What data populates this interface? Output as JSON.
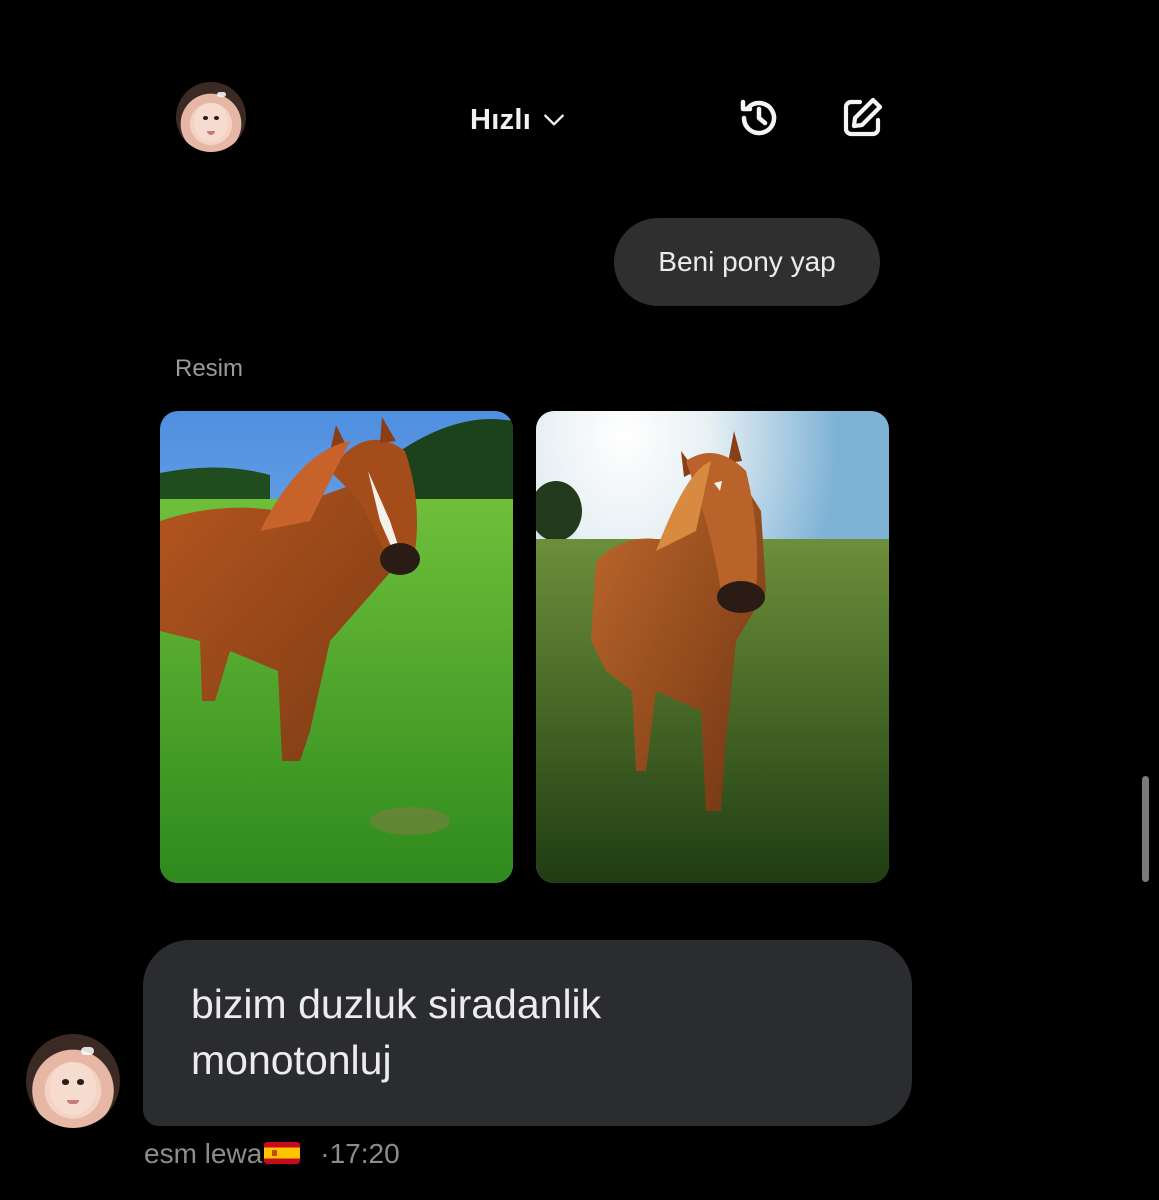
{
  "header": {
    "model_label": "Hızlı",
    "model_chevron_icon": "chevron-down-icon",
    "history_icon": "history-clock-icon",
    "new_chat_icon": "edit-square-icon"
  },
  "conversation": {
    "user_prompt": "Beni pony yap",
    "result_section_label": "Resim",
    "images": [
      {
        "subject": "horse-in-green-pasture"
      },
      {
        "subject": "horse-in-sunlit-field"
      }
    ]
  },
  "reply": {
    "text_line1": "bizim duzluk siradanlik",
    "text_line2": "monotonluj",
    "author": "esm lewa",
    "flag": "spain-flag-emoji",
    "time": "·17:20"
  },
  "colors": {
    "background": "#000000",
    "user_bubble": "#2f2f2f",
    "reply_bubble": "#2b2c30",
    "muted_text": "#8c8c8c"
  }
}
